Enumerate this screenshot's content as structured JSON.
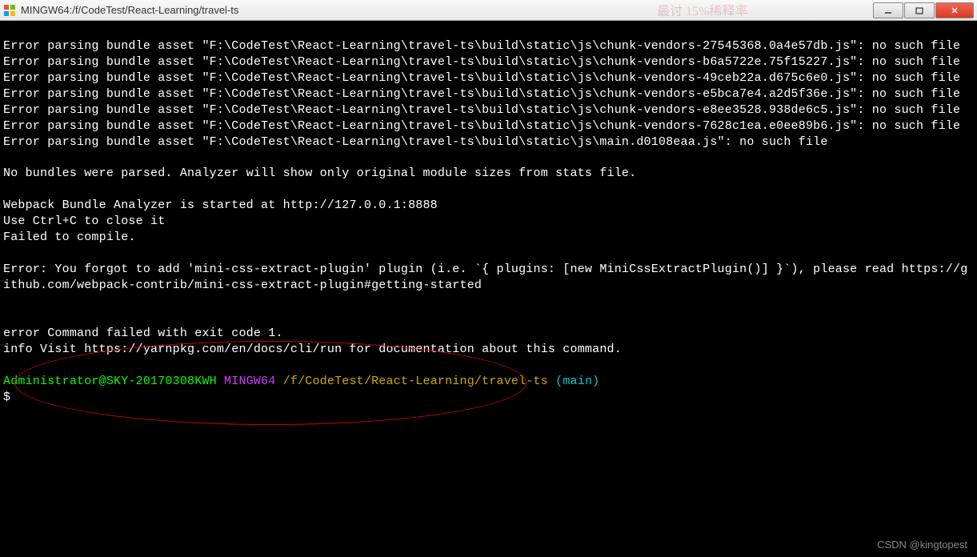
{
  "titlebar": {
    "title": "MINGW64:/f/CodeTest/React-Learning/travel-ts"
  },
  "lines": {
    "err1a": "Error parsing bundle asset \"F:\\CodeTest\\React-Learning\\travel-ts\\build\\static\\js\\chunk-vendors-27545368.0a4e57db.js\": no such file",
    "err2a": "Error parsing bundle asset \"F:\\CodeTest\\React-Learning\\travel-ts\\build\\static\\js\\chunk-vendors-b6a5722e.75f15227.js\": no such file",
    "err3a": "Error parsing bundle asset \"F:\\CodeTest\\React-Learning\\travel-ts\\build\\static\\js\\chunk-vendors-49ceb22a.d675c6e0.js\": no such file",
    "err4a": "Error parsing bundle asset \"F:\\CodeTest\\React-Learning\\travel-ts\\build\\static\\js\\chunk-vendors-e5bca7e4.a2d5f36e.js\": no such file",
    "err5a": "Error parsing bundle asset \"F:\\CodeTest\\React-Learning\\travel-ts\\build\\static\\js\\chunk-vendors-e8ee3528.938de6c5.js\": no such file",
    "err6a": "Error parsing bundle asset \"F:\\CodeTest\\React-Learning\\travel-ts\\build\\static\\js\\chunk-vendors-7628c1ea.e0ee89b6.js\": no such file",
    "err7a": "Error parsing bundle asset \"F:\\CodeTest\\React-Learning\\travel-ts\\build\\static\\js\\main.d0108eaa.js\": no such file",
    "blank": "",
    "nobundles": "No bundles were parsed. Analyzer will show only original module sizes from stats file.",
    "analyzer": "Webpack Bundle Analyzer is started at http://127.0.0.1:8888",
    "ctrlc": "Use Ctrl+C to close it",
    "failed": "Failed to compile.",
    "mainerr": "Error: You forgot to add 'mini-css-extract-plugin' plugin (i.e. `{ plugins: [new MiniCssExtractPlugin()] }`), please read https://github.com/webpack-contrib/mini-css-extract-plugin#getting-started",
    "cmdfail": "error Command failed with exit code 1.",
    "info": "info Visit https://yarnpkg.com/en/docs/cli/run for documentation about this command."
  },
  "prompt": {
    "user": "Administrator@SKY-20170308KWH",
    "host": "MINGW64",
    "path": "/f/CodeTest/React-Learning/travel-ts",
    "branch": "(main)",
    "cursor": "$"
  },
  "watermark": "CSDN @kingtopest"
}
